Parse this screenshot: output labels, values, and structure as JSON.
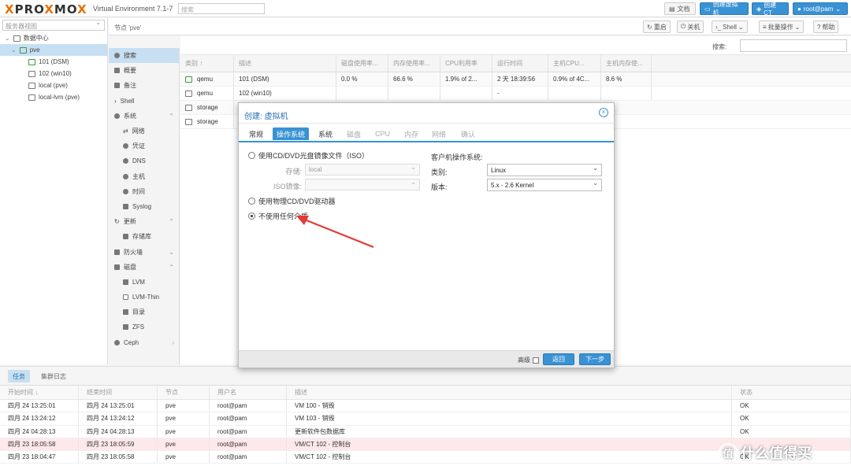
{
  "topbar": {
    "brand_prefix": "PRO",
    "brand_x": "X",
    "brand_mid": "MO",
    "brand_x2": "X",
    "title": "Virtual Environment 7.1-7",
    "search_placeholder": "搜索",
    "docs_label": "文档",
    "create_vm_label": "创建虚拟机",
    "create_ct_label": "创建CT",
    "user_label": "root@pam"
  },
  "tree": {
    "view_select": "服务器视图",
    "items": [
      {
        "label": "数据中心"
      },
      {
        "label": "pve"
      },
      {
        "label": "101 (DSM)"
      },
      {
        "label": "102 (win10)"
      },
      {
        "label": "local (pve)"
      },
      {
        "label": "local-lvm (pve)"
      }
    ]
  },
  "node_header": {
    "title": "节点 'pve'",
    "reboot": "重启",
    "shutdown": "关机",
    "shell": "Shell",
    "bulk": "批量操作",
    "help": "帮助"
  },
  "side_menu": [
    {
      "label": "搜索"
    },
    {
      "label": "概要"
    },
    {
      "label": "备注"
    },
    {
      "label": "Shell"
    },
    {
      "label": "系统"
    },
    {
      "label": "网络"
    },
    {
      "label": "凭证"
    },
    {
      "label": "DNS"
    },
    {
      "label": "主机"
    },
    {
      "label": "时间"
    },
    {
      "label": "Syslog"
    },
    {
      "label": "更新"
    },
    {
      "label": "存储库"
    },
    {
      "label": "防火墙"
    },
    {
      "label": "磁盘"
    },
    {
      "label": "LVM"
    },
    {
      "label": "LVM-Thin"
    },
    {
      "label": "目录"
    },
    {
      "label": "ZFS"
    },
    {
      "label": "Ceph"
    }
  ],
  "grid": {
    "search_label": "搜索:",
    "columns": [
      "类别 ↑",
      "描述",
      "磁盘使用率...",
      "内存使用率...",
      "CPU利用率",
      "运行时间",
      "主机CPU...",
      "主机内存使..."
    ],
    "rows": [
      [
        "qemu",
        "101 (DSM)",
        "0.0 %",
        "66.6 %",
        "1.9% of 2...",
        "2 天 18:39:56",
        "0.9% of 4C...",
        "8.6 %"
      ],
      [
        "qemu",
        "102 (win10)",
        "",
        "",
        "",
        "-",
        "",
        ""
      ],
      [
        "storage",
        "",
        "",
        "",
        "",
        "",
        "",
        ""
      ],
      [
        "storage",
        "",
        "",
        "",
        "",
        "",
        "",
        ""
      ]
    ]
  },
  "modal": {
    "title": "创建: 虚拟机",
    "tabs": [
      "常规",
      "操作系统",
      "系统",
      "磁盘",
      "CPU",
      "内存",
      "网络",
      "确认"
    ],
    "radio_iso": "使用CD/DVD光盘镜像文件（ISO）",
    "storage_label": "存储:",
    "storage_value": "local",
    "iso_label": "ISO镜像:",
    "iso_value": "",
    "radio_physical": "使用物理CD/DVD驱动器",
    "radio_none": "不使用任何介质",
    "guest_os_title": "客户机操作系统:",
    "type_label": "类别:",
    "type_value": "Linux",
    "version_label": "版本:",
    "version_value": "5.x - 2.6 Kernel",
    "advanced_label": "高级",
    "back_label": "返回",
    "next_label": "下一步"
  },
  "tasks": {
    "tab_tasks": "任务",
    "tab_cluster_log": "集群日志",
    "columns": [
      "开始时间 ↓",
      "结束时间",
      "节点",
      "用户名",
      "描述",
      "状态"
    ],
    "rows": [
      [
        "四月 24 13:25:01",
        "四月 24 13:25:01",
        "pve",
        "root@pam",
        "VM 100 - 销毁",
        "OK"
      ],
      [
        "四月 24 13:24:12",
        "四月 24 13:24:12",
        "pve",
        "root@pam",
        "VM 103 - 销毁",
        "OK"
      ],
      [
        "四月 24 04:28:13",
        "四月 24 04:28:13",
        "pve",
        "root@pam",
        "更新软件包数据库",
        "OK"
      ],
      [
        "四月 23 18:05:58",
        "四月 23 18:05:59",
        "pve",
        "root@pam",
        "VM/CT 102 - 控制台",
        ""
      ],
      [
        "四月 23 18:04:47",
        "四月 23 18:05:58",
        "pve",
        "root@pam",
        "VM/CT 102 - 控制台",
        "OK"
      ]
    ]
  },
  "watermark": {
    "circle": "值",
    "text": "什么值得买"
  },
  "colors": {
    "accent": "#3892d4",
    "brand_orange": "#e57000",
    "selection": "#c7dff3",
    "arrow": "#e53935"
  }
}
